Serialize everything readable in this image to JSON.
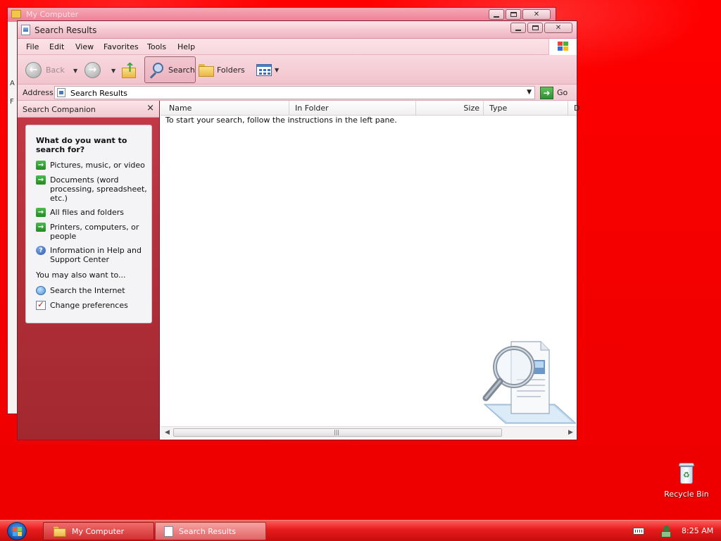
{
  "background_window": {
    "title": "My Computer",
    "side_letters": [
      "A",
      "F"
    ]
  },
  "window": {
    "title": "Search Results",
    "menu": [
      "File",
      "Edit",
      "View",
      "Favorites",
      "Tools",
      "Help"
    ],
    "toolbar": {
      "back_label": "Back",
      "search_label": "Search",
      "folders_label": "Folders"
    },
    "address": {
      "label": "Address",
      "value": "Search Results",
      "go_label": "Go"
    },
    "search_companion": {
      "title": "Search Companion",
      "close_glyph": "×",
      "question": "What do you want to search for?",
      "options": [
        "Pictures, music, or video",
        "Documents (word processing, spreadsheet, etc.)",
        "All files and folders",
        "Printers, computers, or people",
        "Information in Help and Support Center"
      ],
      "also_heading": "You may also want to...",
      "also_options": [
        "Search the Internet",
        "Change preferences"
      ]
    },
    "list": {
      "columns": [
        "Name",
        "In Folder",
        "Size",
        "Type",
        "D"
      ],
      "empty_message": "To start your search, follow the instructions in the left pane."
    }
  },
  "desktop": {
    "icons": [
      {
        "label": "Recycle Bin",
        "icon": "recycle-bin-icon"
      }
    ]
  },
  "taskbar": {
    "buttons": [
      {
        "label": "My Computer",
        "active": false
      },
      {
        "label": "Search Results",
        "active": true
      }
    ],
    "clock": "8:25 AM"
  },
  "colors": {
    "desktop": "#f40000",
    "window_chrome": "#f5c7d1",
    "side_pane": "#b3303a",
    "taskbar": "#e61b1b"
  }
}
